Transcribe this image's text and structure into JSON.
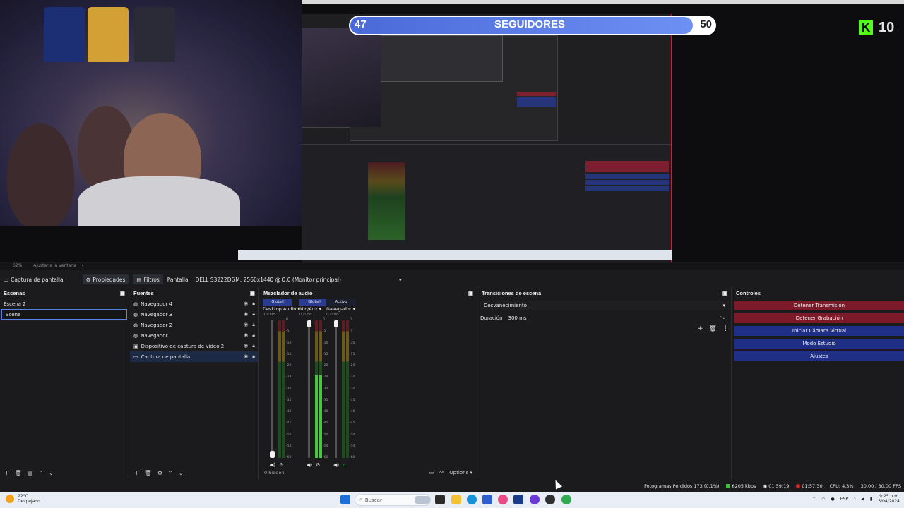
{
  "overlay": {
    "followers_current": "47",
    "followers_label": "SEGUIDORES",
    "followers_goal": "50",
    "followers_progress": 0.94,
    "kick_count": "10",
    "kick_logo_letter": "K"
  },
  "zoom": {
    "level": "62%",
    "fit_label": "Ajustar a la ventana"
  },
  "source_toolbar": {
    "source_name": "Captura de pantalla",
    "properties_label": "Propiedades",
    "filters_label": "Filtros",
    "screen_label": "Pantalla",
    "screen_value": "DELL S3222DGM: 2560x1440 @ 0,0 (Monitor principal)"
  },
  "scenes": {
    "title": "Escenas",
    "items": [
      "Escena 2",
      "Scene"
    ],
    "selected": "Scene"
  },
  "sources": {
    "title": "Fuentes",
    "items": [
      "Navegador 4",
      "Navegador 3",
      "Navegador 2",
      "Navegador",
      "Dispositivo de captura de video 2",
      "Captura de pantalla"
    ]
  },
  "mixer": {
    "title": "Mezclador de audio",
    "channels": [
      {
        "head": "Global",
        "name": "Desktop Audio",
        "db": "-inf dB",
        "level": 0.0,
        "head_color": "#2a3c90"
      },
      {
        "head": "Global",
        "name": "Mic/Aux",
        "db": "0.0 dB",
        "level": 0.6,
        "head_color": "#2a3c90"
      },
      {
        "head": "Activo",
        "name": "Navegador",
        "db": "0.0 dB",
        "level": 0.0,
        "head_color": "#1b1f30"
      }
    ],
    "scale": [
      "0",
      "-5",
      "-10",
      "-15",
      "-20",
      "-24",
      "-30",
      "-35",
      "-40",
      "-45",
      "-50",
      "-54",
      "-60"
    ],
    "hidden_label": "0 hidden",
    "options_label": "Options"
  },
  "transitions": {
    "title": "Transiciones de escena",
    "type": "Desvanecimiento",
    "duration_label": "Duración",
    "duration_value": "300 ms"
  },
  "controls": {
    "title": "Controles",
    "buttons": [
      {
        "label": "Detener Transmisión",
        "style": "red"
      },
      {
        "label": "Detener Grabación",
        "style": "red"
      },
      {
        "label": "Iniciar Cámara Virtual",
        "style": "blue"
      },
      {
        "label": "Modo Estudio",
        "style": "blue"
      },
      {
        "label": "Ajustes",
        "style": "blue"
      }
    ]
  },
  "status": {
    "dropped_frames": "Fotogramas Perdidos 173 (0.1%)",
    "bitrate": "6205 kbps",
    "stream_time": "01:59:19",
    "rec_time": "01:57:30",
    "cpu": "CPU: 4.3%",
    "fps": "30.00 / 30.00 FPS"
  },
  "taskbar": {
    "weather_temp": "22°C",
    "weather_desc": "Despejado",
    "search_placeholder": "Buscar",
    "language": "ESP",
    "time": "9:25 p.m.",
    "date": "3/04/2024"
  },
  "colors": {
    "accent_red": "#c0233a",
    "kick_green": "#53fc18",
    "control_red": "#7d1a2a",
    "control_blue": "#1f2f86",
    "selection": "#1d2a45"
  }
}
